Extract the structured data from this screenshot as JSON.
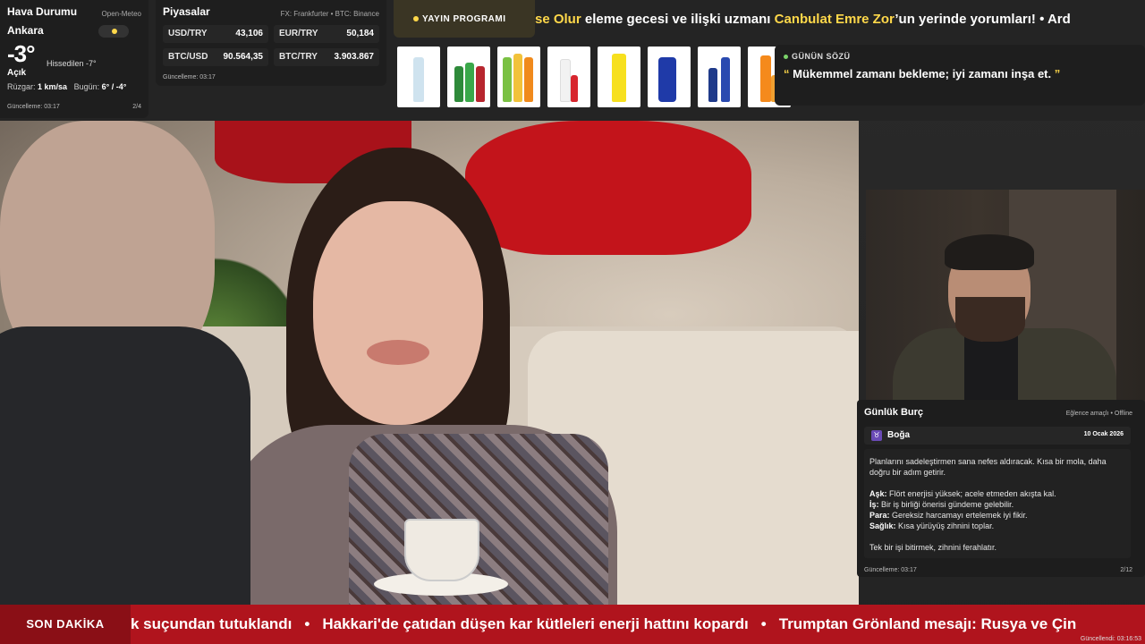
{
  "weather": {
    "title": "Hava Durumu",
    "source": "Open-Meteo",
    "city": "Ankara",
    "temperature": "-3°",
    "feels_like": "Hissedilen -7°",
    "condition": "Açık",
    "wind_label": "Rüzgar:",
    "wind_value": "1 km/sa",
    "today_label": "Bugün:",
    "today_value": "6° / -4°",
    "updated": "Güncelleme: 03:17",
    "page": "2/4"
  },
  "markets": {
    "title": "Piyasalar",
    "source": "FX: Frankfurter • BTC: Binance",
    "items": [
      {
        "label": "USD/TRY",
        "value": "43,106"
      },
      {
        "label": "EUR/TRY",
        "value": "50,184"
      },
      {
        "label": "BTC/USD",
        "value": "90.564,35"
      },
      {
        "label": "BTC/TRY",
        "value": "3.903.867"
      }
    ],
    "updated": "Güncelleme: 03:17"
  },
  "program": {
    "label": "YAYIN PROGRAMI"
  },
  "top_ticker": {
    "part1": "se Olur",
    "part2": " eleme gecesi ve ilişki uzmanı ",
    "part3": "Canbulat Emre Zor",
    "part4": "’un yerinde yorumları!",
    "part5": "  •  Ard"
  },
  "quote": {
    "tag": "GÜNÜN SÖZÜ",
    "open": "“",
    "text": " Mükemmel zamanı bekleme; iyi zamanı inşa et. ",
    "close": "”"
  },
  "horoscope": {
    "title": "Günlük Burç",
    "source": "Eğlence amaçlı • Offline",
    "sign_icon": "♉",
    "sign": "Boğa",
    "date": "10 Ocak 2026",
    "intro": "Planlarını sadeleştirmen sana nefes aldıracak. Kısa bir mola, daha doğru bir adım getirir.",
    "love_label": "Aşk:",
    "love": " Flört enerjisi yüksek; acele etmeden akışta kal.",
    "work_label": "İş:",
    "work": " Bir iş birliği önerisi gündeme gelebilir.",
    "money_label": "Para:",
    "money": " Gereksiz harcamayı ertelemek iyi fikir.",
    "health_label": "Sağlık:",
    "health": " Kısa yürüyüş zihnini toplar.",
    "closing": "Tek bir işi bitirmek, zihnini ferahlatır.",
    "updated": "Güncelleme: 03:17",
    "page": "2/12"
  },
  "breaking": {
    "label": "SON DAKİKA",
    "items": [
      "k suçundan tutuklandı",
      "Hakkari'de çatıdan düşen kar kütleleri enerji hattını kopardı",
      "Trumptan Grönland mesajı: Rusya ve Çin"
    ],
    "separator": "•",
    "updated": "Güncellendi: 03:16:53"
  },
  "colors": {
    "accent": "#ffd84a",
    "breaking_bg": "#b0141d",
    "panel": "#1e1e1e"
  }
}
